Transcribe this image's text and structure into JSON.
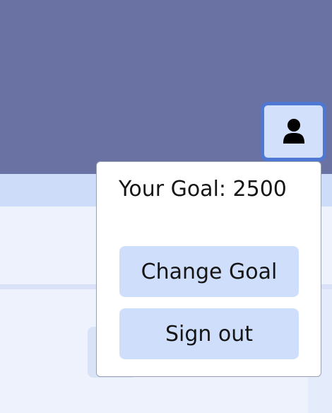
{
  "header": {
    "profile_button": {
      "icon": "user-icon",
      "background_color": "#d3e0fb",
      "border_color": "#4f78d4"
    }
  },
  "popup": {
    "goal_text": "Your Goal: 2500",
    "change_goal_label": "Change Goal",
    "sign_out_label": "Sign out"
  },
  "colors": {
    "header_bg": "#6a72a3",
    "button_bg": "#cfdefb",
    "page_bg": "#edf1fd"
  }
}
